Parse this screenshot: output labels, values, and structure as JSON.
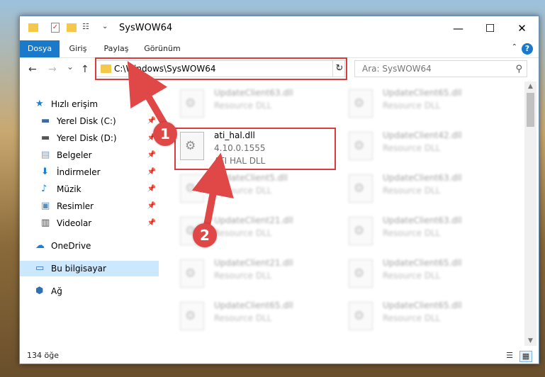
{
  "window": {
    "title": "SysWOW64",
    "controls": {
      "minimize": "—",
      "maximize": "☐",
      "close": "✕"
    }
  },
  "ribbon": {
    "tabs": [
      {
        "label": "Dosya",
        "active": true
      },
      {
        "label": "Giriş",
        "active": false
      },
      {
        "label": "Paylaş",
        "active": false
      },
      {
        "label": "Görünüm",
        "active": false
      }
    ],
    "help": "?"
  },
  "navigation": {
    "back": "←",
    "forward": "→",
    "recent": "⌄",
    "up": "↑",
    "address_path": "C:\\Windows\\SysWOW64",
    "refresh": "↻",
    "search_placeholder": "Ara: SysWOW64",
    "search_icon": "⚲"
  },
  "sidebar": {
    "items": [
      {
        "label": "Hızlı erişim",
        "icon": "star-icon",
        "color": "#1c7fd6",
        "pinned": false
      },
      {
        "label": "Yerel Disk (C:)",
        "icon": "drive-icon",
        "color": "#3d6aa3",
        "pinned": true
      },
      {
        "label": "Yerel Disk (D:)",
        "icon": "drive-icon",
        "color": "#555555",
        "pinned": true
      },
      {
        "label": "Belgeler",
        "icon": "documents-icon",
        "color": "#7a9fc8",
        "pinned": true
      },
      {
        "label": "İndirmeler",
        "icon": "download-icon",
        "color": "#1c7fd6",
        "pinned": true
      },
      {
        "label": "Müzik",
        "icon": "music-icon",
        "color": "#1c7fd6",
        "pinned": true
      },
      {
        "label": "Resimler",
        "icon": "pictures-icon",
        "color": "#5a8fc0",
        "pinned": true
      },
      {
        "label": "Videolar",
        "icon": "video-icon",
        "color": "#444444",
        "pinned": true
      },
      {
        "label": "OneDrive",
        "icon": "cloud-icon",
        "color": "#1c7fd6",
        "pinned": false
      },
      {
        "label": "Bu bilgisayar",
        "icon": "computer-icon",
        "color": "#2f6fb3",
        "pinned": false,
        "selected": true
      },
      {
        "label": "Ağ",
        "icon": "network-icon",
        "color": "#2f6fb3",
        "pinned": false
      }
    ],
    "pin_glyph": "📌"
  },
  "files": [
    {
      "name": "UpdateClient63.dll",
      "sub": "Resource DLL",
      "blurred": true
    },
    {
      "name": "UpdateClient65.dll",
      "sub": "Resource DLL",
      "blurred": true
    },
    {
      "name": "ati_hal.dll",
      "sub": "4.10.0.1555",
      "sub2": "ATI HAL DLL",
      "blurred": false
    },
    {
      "name": "UpdateClient42.dll",
      "sub": "Resource DLL",
      "blurred": true
    },
    {
      "name": "UpdateClient5.dll",
      "sub": "Resource DLL",
      "blurred": true
    },
    {
      "name": "UpdateClient63.dll",
      "sub": "Resource DLL",
      "blurred": true
    },
    {
      "name": "UpdateClient21.dll",
      "sub": "Resource DLL",
      "blurred": true
    },
    {
      "name": "UpdateClient63.dll",
      "sub": "Resource DLL",
      "blurred": true
    },
    {
      "name": "UpdateClient21.dll",
      "sub": "Resource DLL",
      "blurred": true
    },
    {
      "name": "UpdateClient65.dll",
      "sub": "Resource DLL",
      "blurred": true
    },
    {
      "name": "UpdateClient65.dll",
      "sub": "Resource DLL",
      "blurred": true
    },
    {
      "name": "UpdateClient65.dll",
      "sub": "Resource DLL",
      "blurred": true
    }
  ],
  "status": {
    "item_count": "134 öğe"
  },
  "annotations": {
    "callout_1": "1",
    "callout_2": "2",
    "highlight_color": "#dd3b3b"
  }
}
